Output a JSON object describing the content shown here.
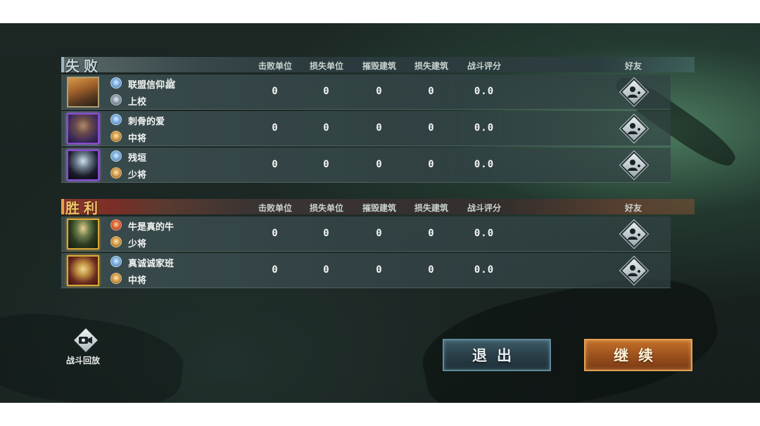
{
  "colors": {
    "lose_accent": "#9fb6c4",
    "win_accent": "#e8a04a",
    "exit_button": "#2a3f49",
    "continue_button": "#9a4f1c"
  },
  "columns": {
    "kills": "击败单位",
    "losses": "损失单位",
    "destroyed": "摧毁建筑",
    "lost_buildings": "损失建筑",
    "score": "战斗评分",
    "friend": "好友"
  },
  "lose": {
    "title": "失败",
    "players": [
      {
        "name": "联盟信仰ﷺ",
        "rank": "上校",
        "faction_icon": "globe-emblem-icon",
        "kills": "0",
        "losses": "0",
        "destroyed": "0",
        "lost_buildings": "0",
        "score": "0.0"
      },
      {
        "name": "刺骨的爱",
        "rank": "中将",
        "faction_icon": "globe-emblem-icon",
        "kills": "0",
        "losses": "0",
        "destroyed": "0",
        "lost_buildings": "0",
        "score": "0.0"
      },
      {
        "name": "残垣",
        "rank": "少将",
        "faction_icon": "globe-emblem-icon",
        "kills": "0",
        "losses": "0",
        "destroyed": "0",
        "lost_buildings": "0",
        "score": "0.0"
      }
    ]
  },
  "win": {
    "title": "胜利",
    "players": [
      {
        "name": "牛是真的牛",
        "rank": "少将",
        "faction_icon": "gear-emblem-icon",
        "kills": "0",
        "losses": "0",
        "destroyed": "0",
        "lost_buildings": "0",
        "score": "0.0"
      },
      {
        "name": "真诚诚家班",
        "rank": "中将",
        "faction_icon": "globe-emblem-icon",
        "kills": "0",
        "losses": "0",
        "destroyed": "0",
        "lost_buildings": "0",
        "score": "0.0"
      }
    ]
  },
  "replay": {
    "label": "战斗回放",
    "icon": "video-camera-icon"
  },
  "buttons": {
    "exit": "退出",
    "continue": "继续"
  }
}
